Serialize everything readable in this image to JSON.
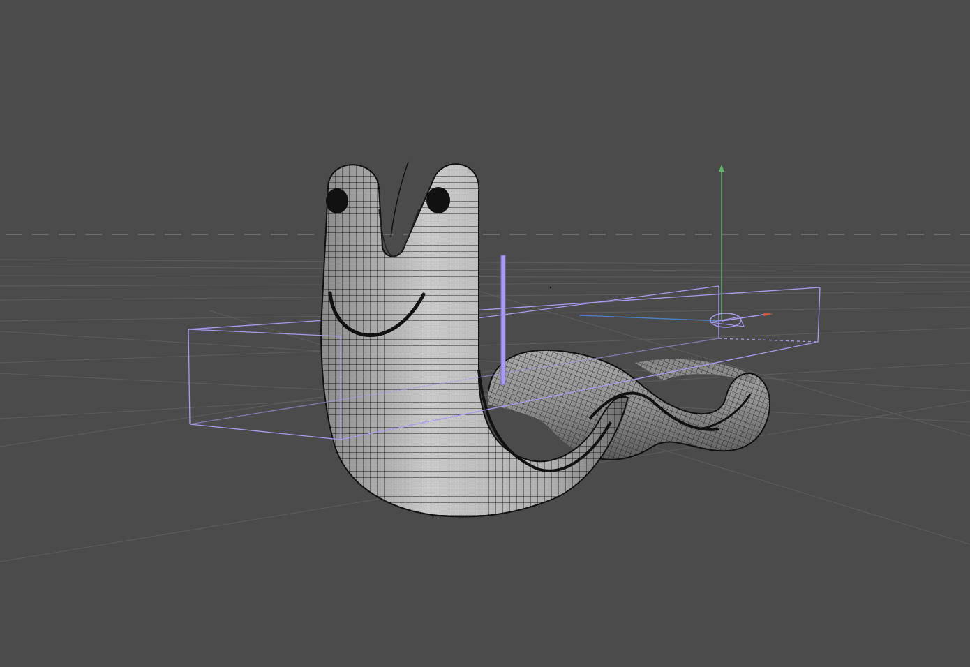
{
  "viewport": {
    "background_color": "#4b4b4b",
    "grid_color": "#5f5f5f",
    "horizon_color": "#767676",
    "bounding_box_color": "#a99cf0",
    "axis_y_color": "#5fb86a",
    "axis_x_color": "#d05a3a",
    "axis_z_color": "#4a82c9",
    "mesh_fill": "#9c9c9c",
    "wire_color": "#1a1a1a"
  },
  "object": {
    "name_icon": "worm-mesh-object",
    "expression_icon": "smile-face-icon"
  }
}
